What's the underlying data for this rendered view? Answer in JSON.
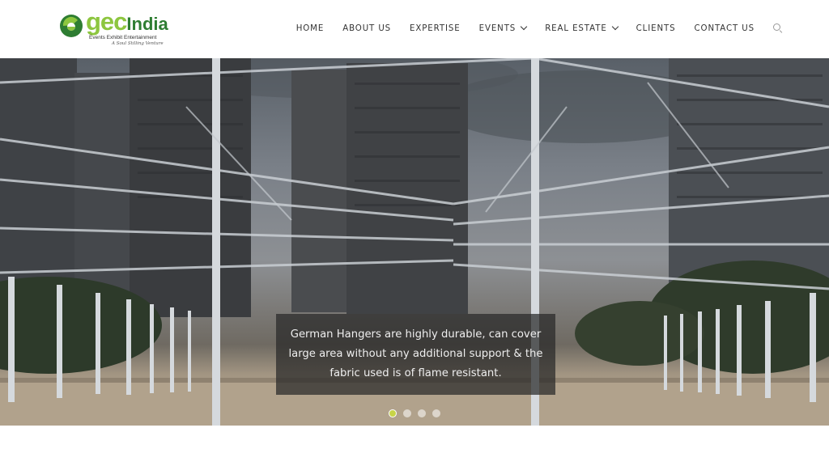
{
  "brand": {
    "name_part1": "gec",
    "name_part2": "India",
    "tagline": "Events Exhibit Entertainment",
    "subtagline": "A Soul Stilling Venture",
    "colors": {
      "green_light": "#8dc63f",
      "green_dark": "#2e7d32"
    }
  },
  "nav": {
    "items": [
      {
        "label": "HOME",
        "has_dropdown": false
      },
      {
        "label": "ABOUT US",
        "has_dropdown": false
      },
      {
        "label": "EXPERTISE",
        "has_dropdown": false
      },
      {
        "label": "EVENTS",
        "has_dropdown": true
      },
      {
        "label": "REAL ESTATE",
        "has_dropdown": true
      },
      {
        "label": "CLIENTS",
        "has_dropdown": false
      },
      {
        "label": "CONTACT US",
        "has_dropdown": false
      }
    ],
    "search_icon": "search-icon"
  },
  "hero": {
    "caption": "German Hangers are highly durable, can cover large area without any additional support & the fabric used is of flame resistant.",
    "slide_count": 4,
    "active_slide": 1,
    "active_dot_color": "#c7d447"
  }
}
